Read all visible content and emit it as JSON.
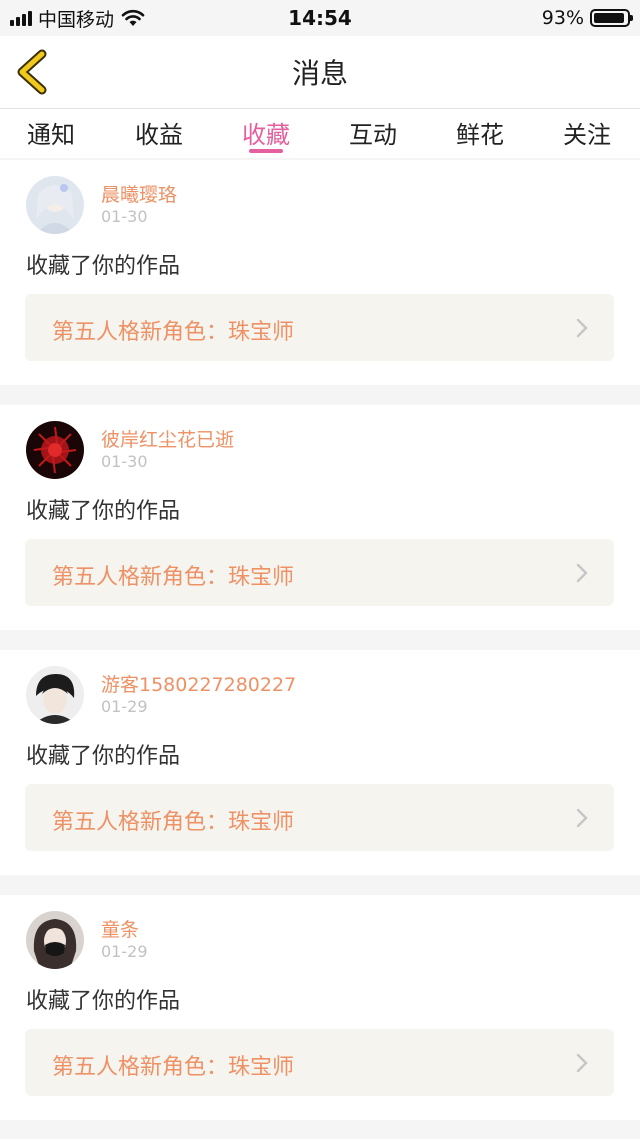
{
  "status_bar": {
    "carrier": "中国移动",
    "time": "14:54",
    "battery": "93%",
    "battery_level": 0.93
  },
  "header": {
    "title": "消息"
  },
  "tabs": [
    {
      "label": "通知"
    },
    {
      "label": "收益"
    },
    {
      "label": "收藏"
    },
    {
      "label": "互动"
    },
    {
      "label": "鲜花"
    },
    {
      "label": "关注"
    }
  ],
  "active_tab": "收藏",
  "colors": {
    "accent_pink": "#e4609e",
    "accent_orange": "#ee9165",
    "work_bg": "#f5f4ef"
  },
  "messages": [
    {
      "username": "晨曦璎珞",
      "date": "01-30",
      "action": "收藏了你的作品",
      "work_title": "第五人格新角色：珠宝师"
    },
    {
      "username": "彼岸红尘花已逝",
      "date": "01-30",
      "action": "收藏了你的作品",
      "work_title": "第五人格新角色：珠宝师"
    },
    {
      "username": "游客1580227280227",
      "date": "01-29",
      "action": "收藏了你的作品",
      "work_title": "第五人格新角色：珠宝师"
    },
    {
      "username": "童条",
      "date": "01-29",
      "action": "收藏了你的作品",
      "work_title": "第五人格新角色：珠宝师"
    }
  ]
}
